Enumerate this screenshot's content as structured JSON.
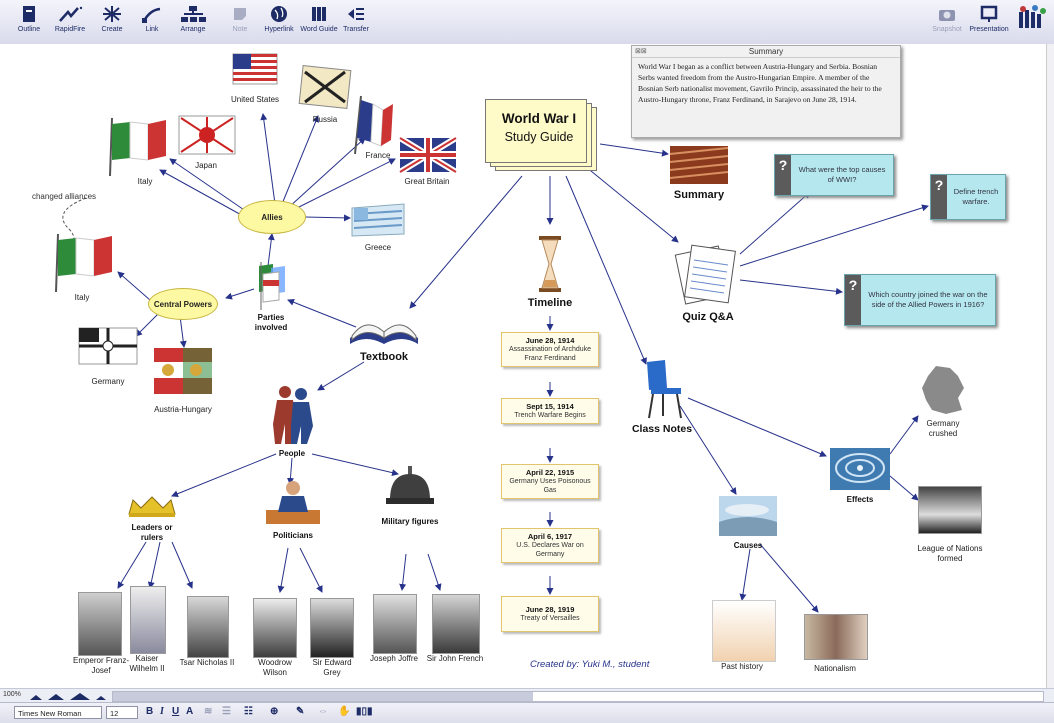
{
  "toolbar": {
    "left_buttons": [
      "Outline",
      "RapidFire",
      "Create",
      "Link",
      "Arrange",
      "Note",
      "Hyperlink",
      "Word Guide",
      "Transfer"
    ],
    "right_buttons": [
      "Snapshot",
      "Presentation"
    ]
  },
  "summary": {
    "title": "Summary",
    "text": "World War I began as a conflict between Austria-Hungary and Serbia. Bosnian Serbs wanted freedom from the Austro-Hungarian Empire. A member of the Bosnian Serb nationalist movement, Gavrilo Princip, assassinated the heir to the Austro-Hungary throne, Franz Ferdinand, in Sarajevo on June 28, 1914."
  },
  "main": {
    "title_line1": "World War I",
    "title_line2": "Study Guide"
  },
  "allies": {
    "label": "Allies",
    "members": [
      "United States",
      "Russia",
      "Japan",
      "France",
      "Great Britain",
      "Italy",
      "Greece"
    ]
  },
  "changed_alliances": "changed alliances",
  "central_powers": {
    "label": "Central Powers",
    "members": [
      "Italy",
      "Germany",
      "Austria-Hungary"
    ]
  },
  "parties_involved": "Parties involved",
  "textbook": "Textbook",
  "people": {
    "label": "People",
    "groups": [
      "Leaders or rulers",
      "Politicians",
      "Military figures"
    ],
    "persons": [
      "Emperor Franz-Josef",
      "Kaiser Wilhelm II",
      "Tsar Nicholas II",
      "Woodrow Wilson",
      "Sir Edward Grey",
      "Joseph Joffre",
      "Sir John French"
    ]
  },
  "timeline": {
    "label": "Timeline",
    "events": [
      {
        "date": "June 28, 1914",
        "text": "Assassination of Archduke Franz Ferdinand"
      },
      {
        "date": "Sept 15, 1914",
        "text": "Trench Warfare Begins"
      },
      {
        "date": "April 22, 1915",
        "text": "Germany Uses Poisonous Gas"
      },
      {
        "date": "April 6, 1917",
        "text": "U.S. Declares War on Germany"
      },
      {
        "date": "June 28, 1919",
        "text": "Treaty of Versailles"
      }
    ]
  },
  "summary_node": "Summary",
  "quiz": {
    "label": "Quiz Q&A",
    "questions": [
      "What were the top causes of WWI?",
      "Define trench warfare.",
      "Which country joined the war on the side of the Allied Powers in 1916?"
    ]
  },
  "class_notes": {
    "label": "Class Notes",
    "causes": "Causes",
    "effects": "Effects",
    "items": [
      "Germany crushed",
      "League of Nations formed",
      "Past history",
      "Nationalism"
    ]
  },
  "credit": "Created by:  Yuki M., student",
  "format_bar": {
    "font": "Times New Roman",
    "size": "12",
    "zoom": "100%"
  },
  "colors": {
    "link": "#27328a",
    "ellipse_fill": "#fdf9a3",
    "card_fill": "#b5e8ee",
    "note_fill": "#fffcea"
  }
}
